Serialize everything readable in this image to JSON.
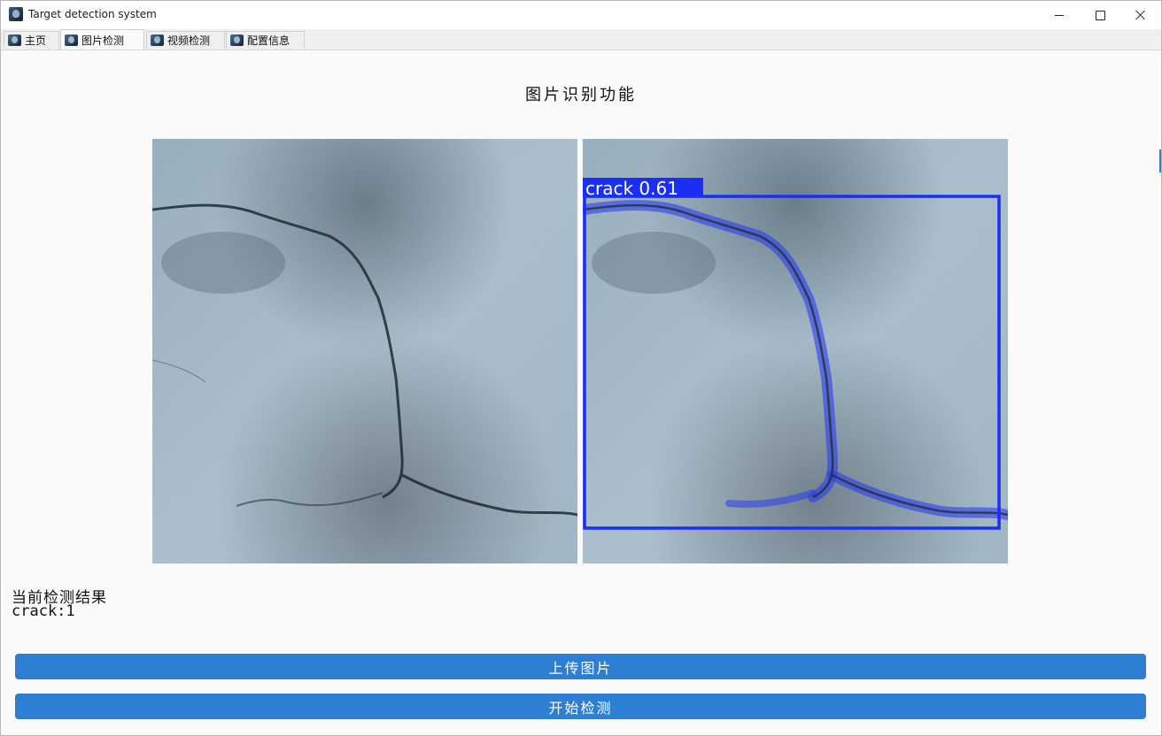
{
  "window": {
    "title": "Target detection system"
  },
  "tabs": [
    {
      "label": "主页"
    },
    {
      "label": "图片检测"
    },
    {
      "label": "视频检测"
    },
    {
      "label": "配置信息"
    }
  ],
  "active_tab": "图片检测",
  "page": {
    "title": "图片识别功能"
  },
  "detection": {
    "box_label": "crack 0.61",
    "box_color": "#1a2ef5",
    "result_heading": "当前检测结果",
    "result_text": "crack:1"
  },
  "buttons": {
    "upload_label": "上传图片",
    "detect_label": "开始检测",
    "color": "#2e7ed3"
  },
  "icons": {
    "app": "app-logo-icon",
    "minimize": "minimize-icon",
    "maximize": "maximize-icon",
    "close": "close-icon"
  }
}
